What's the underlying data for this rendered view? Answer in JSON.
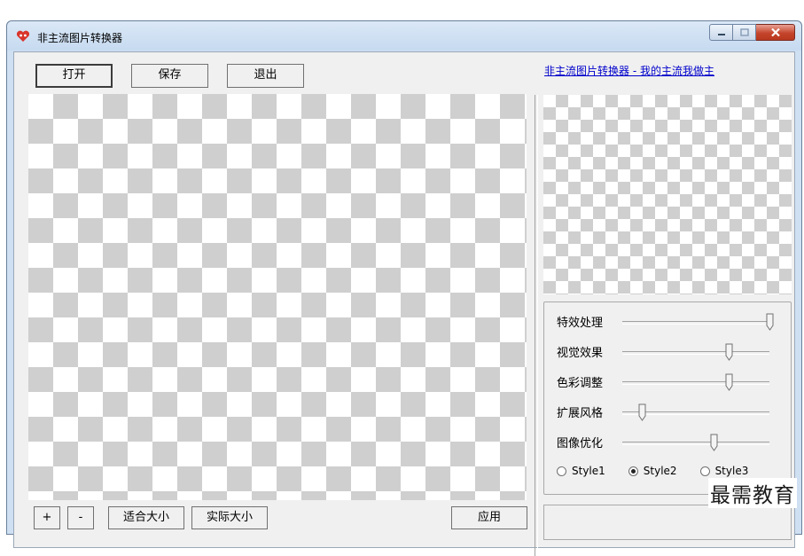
{
  "window": {
    "title": "非主流图片转换器"
  },
  "toolbar": {
    "open_label": "打开",
    "save_label": "保存",
    "exit_label": "退出"
  },
  "header_link": "非主流图片转换器 - 我的主流我做主",
  "bottom_bar": {
    "zoom_in_label": "+",
    "zoom_out_label": "-",
    "fit_label": "适合大小",
    "actual_label": "实际大小",
    "apply_label": "应用"
  },
  "sliders": [
    {
      "label": "特效处理",
      "value": 1.0
    },
    {
      "label": "视觉效果",
      "value": 0.72
    },
    {
      "label": "色彩调整",
      "value": 0.72
    },
    {
      "label": "扩展风格",
      "value": 0.13
    },
    {
      "label": "图像优化",
      "value": 0.62
    }
  ],
  "styles": {
    "options": [
      "Style1",
      "Style2",
      "Style3"
    ],
    "selected": "Style2"
  },
  "watermark": "最需教育",
  "colors": {
    "window_frame": "#cfe0f3",
    "client_bg": "#f0f0f0",
    "link": "#0000cc",
    "close_button": "#c5452c"
  }
}
